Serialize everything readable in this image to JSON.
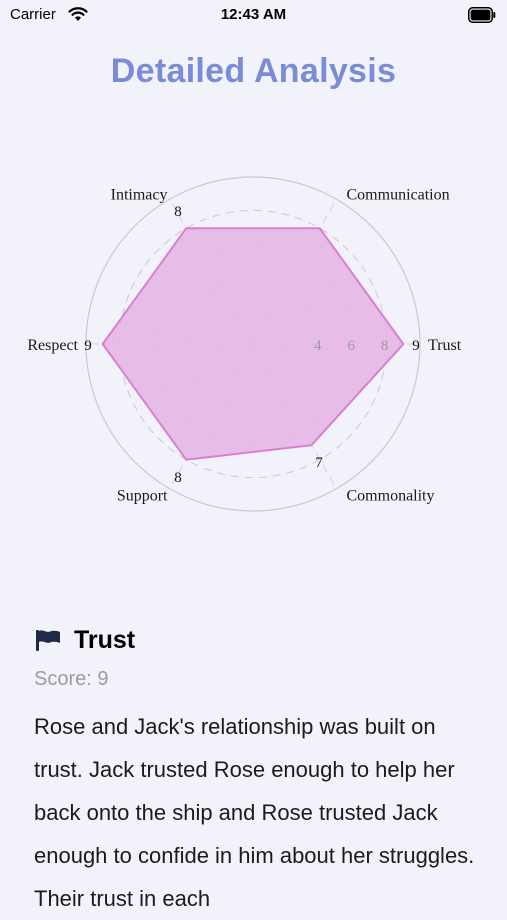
{
  "status_bar": {
    "carrier": "Carrier",
    "time": "12:43 AM"
  },
  "page_title": "Detailed Analysis",
  "chart_data": {
    "type": "radar",
    "axes": [
      "Trust",
      "Communication",
      "Intimacy",
      "Respect",
      "Support",
      "Commonality"
    ],
    "values": [
      9,
      8,
      8,
      9,
      8,
      7
    ],
    "rmax": 10,
    "tick_labels": [
      "4",
      "6",
      "8"
    ],
    "fill_color": "#e6b6e3",
    "stroke_color": "#d77fd3"
  },
  "detail": {
    "icon": "flag-icon",
    "title": "Trust",
    "score": "Score: 9",
    "description": "Rose and Jack's relationship was built on trust. Jack trusted Rose enough to help her back onto the ship and Rose trusted Jack enough to confide in him about her struggles. Their trust in each"
  }
}
